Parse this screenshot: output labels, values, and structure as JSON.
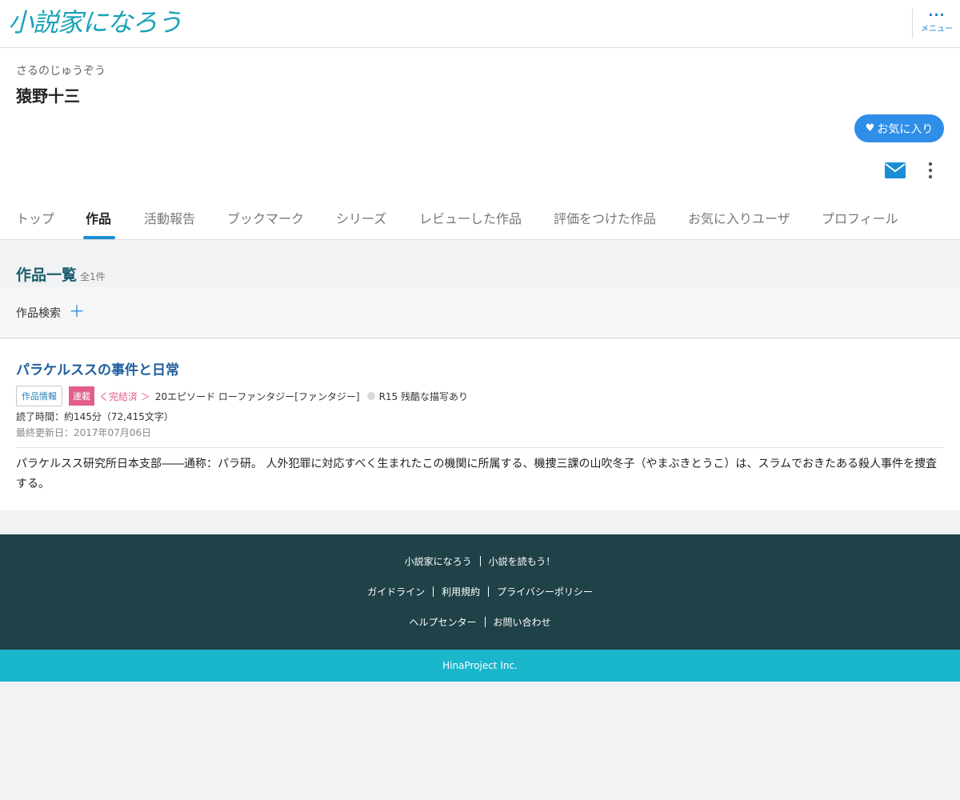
{
  "header": {
    "logo_text": "小説家になろう",
    "menu_dots": "···",
    "menu_label": "メニュー"
  },
  "user": {
    "kana": "さるのじゅうぞう",
    "name": "猿野十三",
    "favorite_button": "お気に入り",
    "heart_icon": "♥"
  },
  "tabs": [
    {
      "label": "トップ",
      "active": false
    },
    {
      "label": "作品",
      "active": true
    },
    {
      "label": "活動報告",
      "active": false
    },
    {
      "label": "ブックマーク",
      "active": false
    },
    {
      "label": "シリーズ",
      "active": false
    },
    {
      "label": "レビューした作品",
      "active": false
    },
    {
      "label": "評価をつけた作品",
      "active": false
    },
    {
      "label": "お気に入りユーザ",
      "active": false
    },
    {
      "label": "プロフィール",
      "active": false
    }
  ],
  "works_section": {
    "title": "作品一覧",
    "count": "全1件",
    "search_label": "作品検索",
    "search_toggle": "＋"
  },
  "work": {
    "title": "パラケルススの事件と日常",
    "info_tag": "作品情報",
    "serial_tag": "連載",
    "completed": "く完結済 ＞",
    "episodes_genre": "20エピソード ローファンタジー[ファンタジー]",
    "rating": "R15 残酷な描写あり",
    "read_time": "読了時間：約145分（72,415文字）",
    "updated": "最終更新日：2017年07月06日",
    "summary": "パラケルスス研究所日本支部――通称：パラ研。 人外犯罪に対応すべく生まれたこの機関に所属する、機捜三課の山吹冬子（やまぶきとうこ）は、スラムでおきたある殺人事件を捜査する。"
  },
  "footer": {
    "row1": [
      "小説家になろう",
      "小説を読もう！"
    ],
    "row2": [
      "ガイドライン",
      "利用規約",
      "プライバシーポリシー"
    ],
    "row3": [
      "ヘルプセンター",
      "お問い合わせ"
    ],
    "copyright": "HinaProject Inc."
  },
  "colors": {
    "accent_blue": "#2f8ee8",
    "logo_teal": "#1aa3b8",
    "serial_pink": "#e35d8d",
    "footer_dark": "#1f4147",
    "footer_teal": "#19b6cc"
  }
}
